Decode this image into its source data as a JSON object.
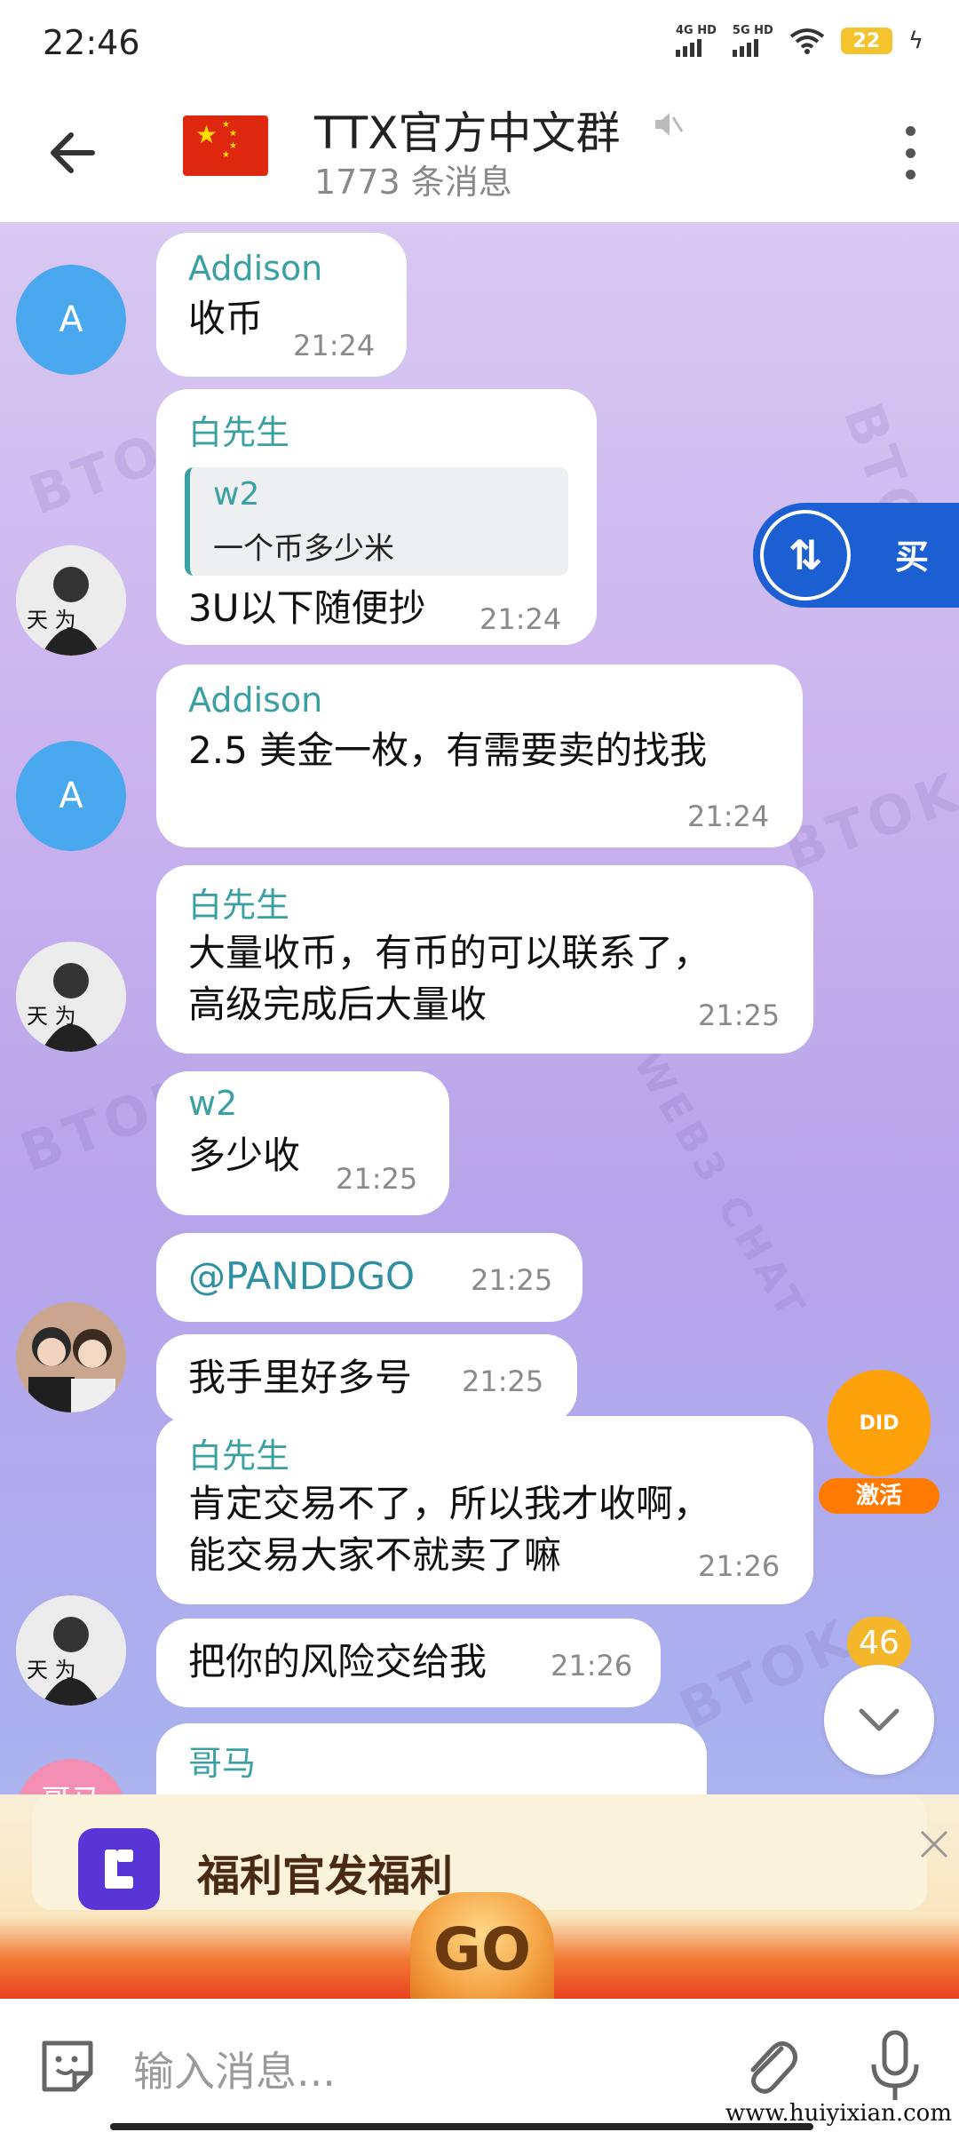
{
  "status_bar": {
    "time": "22:46",
    "network_1": "4G HD",
    "network_2": "5G HD",
    "battery": "22"
  },
  "header": {
    "title": "TTX官方中文群",
    "subtitle": "1773 条消息",
    "flag_icon": "china-flag-icon"
  },
  "messages": [
    {
      "sender": "Addison",
      "avatar_letter": "A",
      "text": "收币",
      "time": "21:24"
    },
    {
      "sender": "白先生",
      "reply_to": {
        "name": "w2",
        "text": "一个币多少米"
      },
      "text": "3U以下随便抄",
      "time": "21:24"
    },
    {
      "sender": "Addison",
      "avatar_letter": "A",
      "text": "2.5 美金一枚，有需要卖的找我",
      "time": "21:24"
    },
    {
      "sender": "白先生",
      "lines": [
        "大量收币，有币的可以联系了，",
        "高级完成后大量收"
      ],
      "time": "21:25"
    },
    {
      "sender": "w2",
      "text": "多少收",
      "time": "21:25"
    },
    {
      "text": "@PANDDGO",
      "time": "21:25"
    },
    {
      "text": "我手里好多号",
      "time": "21:25"
    },
    {
      "sender": "白先生",
      "lines": [
        "肯定交易不了，所以我才收啊，",
        "能交易大家不就卖了嘛"
      ],
      "time": "21:26"
    },
    {
      "text": "把你的风险交给我",
      "time": "21:26"
    },
    {
      "sender": "哥马",
      "avatar_text": "哥马"
    }
  ],
  "trade_button": {
    "label": "买"
  },
  "did_badge": {
    "text": "DID",
    "label": "激活"
  },
  "unread_count": "46",
  "promo": {
    "text": "福利官发福利",
    "go": "GO"
  },
  "input": {
    "placeholder": "输入消息..."
  },
  "watermark": "www.huiyixian.com",
  "background_marks": [
    "BTOK",
    "BTOK",
    "BTOK",
    "BTOK",
    "BTOK",
    "WEB3 CHAT"
  ],
  "colors": {
    "accent_name": "#3aa0a4",
    "trade": "#1b5fd2",
    "did": "#ffa10a",
    "unread": "#f4b62b"
  }
}
